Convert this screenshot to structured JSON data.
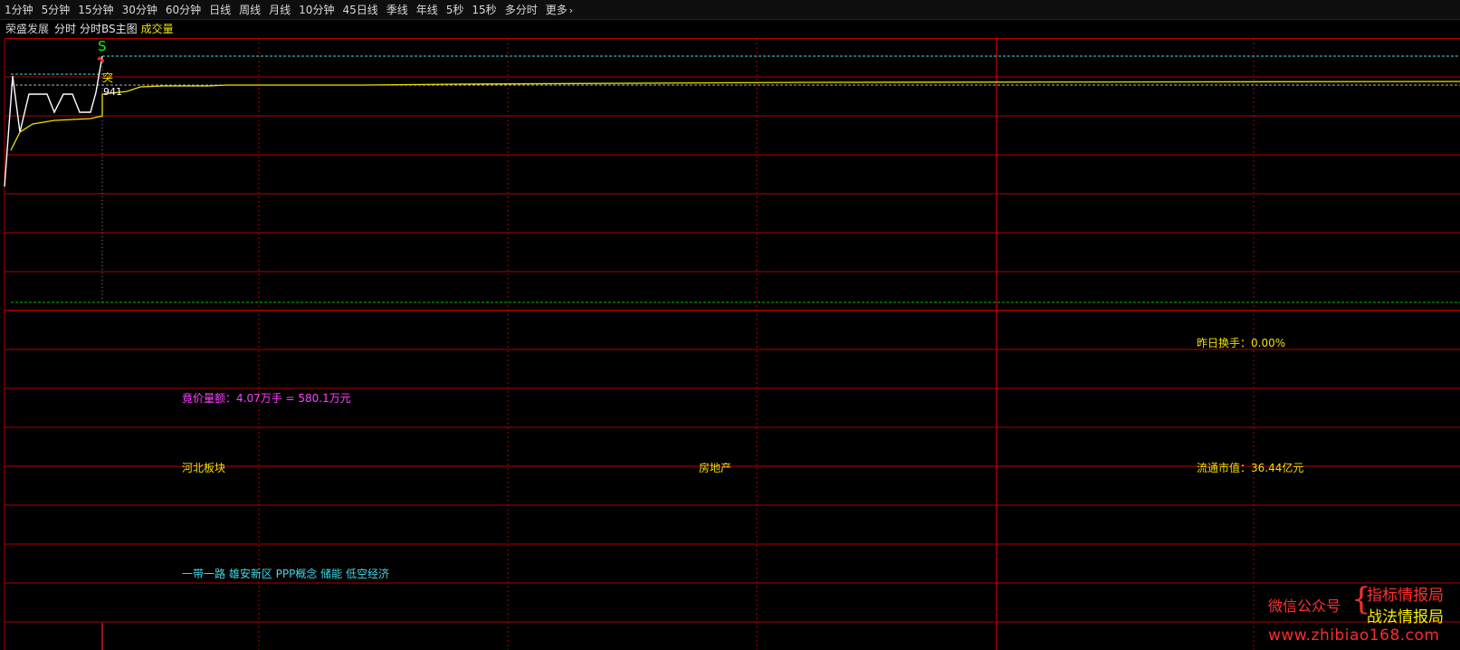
{
  "toolbar": {
    "items": [
      "1分钟",
      "5分钟",
      "15分钟",
      "30分钟",
      "60分钟",
      "日线",
      "周线",
      "月线",
      "10分钟",
      "45日线",
      "季线",
      "年线",
      "5秒",
      "15秒",
      "多分时",
      "更多"
    ]
  },
  "title": {
    "stock": "荣盛发展",
    "mode1": "分时",
    "mode2": "分时BS主图",
    "indicator": "成交量"
  },
  "markers": {
    "signal": "S",
    "break_label": "突",
    "volume_label": "941"
  },
  "info": {
    "auction": "竟价量额：4.07万手 = 580.1万元",
    "turnover_yesterday": "昨日换手：0.00%",
    "sector_region": "河北板块",
    "sector_industry": "房地产",
    "float_mktcap": "流通市值：36.44亿元",
    "concepts": "一带一路 雄安新区 PPP概念 储能 低空经济"
  },
  "watermark": {
    "wechat": "微信公众号",
    "name1": "指标情报局",
    "name2": "战法情报局",
    "site": "www.zhibiao168.com"
  },
  "colors": {
    "grid": "#b00000",
    "price_line": "#ffffff",
    "avg_line": "#f0e000",
    "cyan_ref": "#40d8e8",
    "green_ref": "#00c000",
    "signal": "#00ff00",
    "auction_text": "#ff40ff",
    "concept_text": "#40d8e8",
    "info_text": "#f0e000"
  },
  "icons": {
    "more": "chevron-right-icon"
  }
}
